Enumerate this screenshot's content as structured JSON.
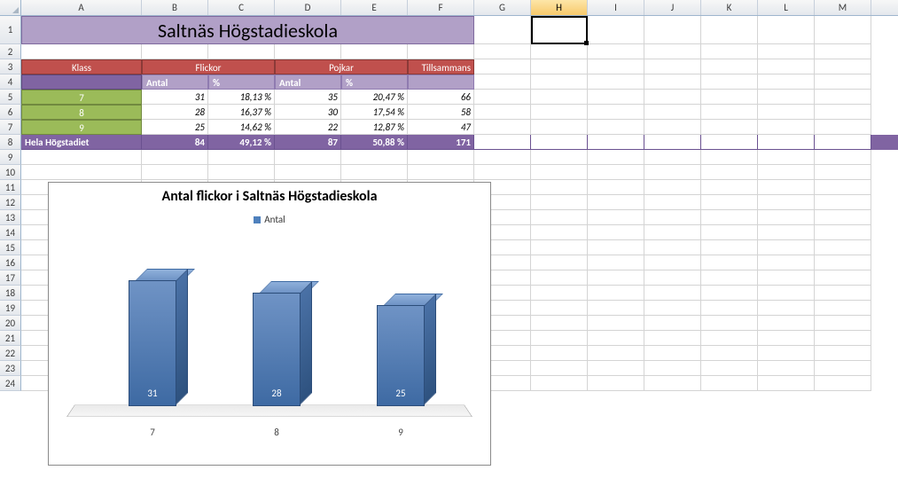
{
  "columns": [
    "A",
    "B",
    "C",
    "D",
    "E",
    "F",
    "G",
    "H",
    "I",
    "J",
    "K",
    "L",
    "M"
  ],
  "row_numbers": [
    1,
    2,
    3,
    4,
    5,
    6,
    7,
    8,
    9,
    10,
    11,
    12,
    13,
    14,
    15,
    16,
    17,
    18,
    19,
    20,
    21,
    22,
    23,
    24
  ],
  "active_cell": "H1",
  "title": "Saltnäs Högstadieskola",
  "headers": {
    "klass": "Klass",
    "flickor": "Flickor",
    "pojkar": "Pojkar",
    "tillsammans": "Tillsammans",
    "antal": "Antal",
    "percent": "%"
  },
  "rows": [
    {
      "klass": "7",
      "f_antal": "31",
      "f_pct": "18,13 %",
      "p_antal": "35",
      "p_pct": "20,47 %",
      "sum": "66"
    },
    {
      "klass": "8",
      "f_antal": "28",
      "f_pct": "16,37 %",
      "p_antal": "30",
      "p_pct": "17,54 %",
      "sum": "58"
    },
    {
      "klass": "9",
      "f_antal": "25",
      "f_pct": "14,62 %",
      "p_antal": "22",
      "p_pct": "12,87 %",
      "sum": "47"
    }
  ],
  "total": {
    "label": "Hela Högstadiet",
    "f_antal": "84",
    "f_pct": "49,12 %",
    "p_antal": "87",
    "p_pct": "50,88 %",
    "sum": "171"
  },
  "chart_data": {
    "type": "bar",
    "title": "Antal flickor i Saltnäs Högstadieskola",
    "legend": "Antal",
    "categories": [
      "7",
      "8",
      "9"
    ],
    "values": [
      31,
      28,
      25
    ],
    "ylim": [
      0,
      35
    ]
  }
}
